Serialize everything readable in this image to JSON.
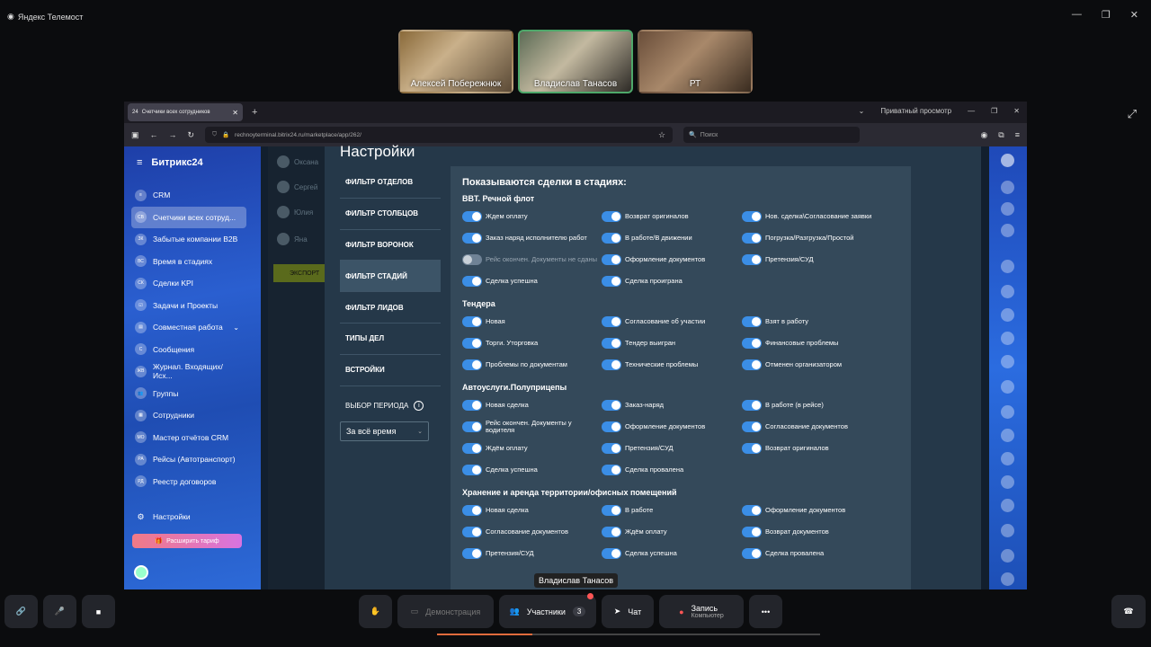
{
  "app": {
    "title": "Яндекс Телемост"
  },
  "participants": [
    {
      "name": "Алексей Побережнюк"
    },
    {
      "name": "Владислав Танасов"
    },
    {
      "name": "РТ"
    }
  ],
  "browser": {
    "tab_title": "Счетчики всех сотрудников",
    "private_label": "Приватный просмотр",
    "url": "rechnoyterminal.bitrix24.ru/marketplace/app/262/",
    "search_placeholder": "Поиск"
  },
  "sidebar": {
    "logo": "Битрикс24",
    "items": [
      {
        "icon": "≡",
        "label": "CRM"
      },
      {
        "icon": "СВ",
        "label": "Счетчики всех сотруд..."
      },
      {
        "icon": "ЗК",
        "label": "Забытые компании B2B"
      },
      {
        "icon": "ВС",
        "label": "Время в стадиях"
      },
      {
        "icon": "СК",
        "label": "Сделки KPI"
      },
      {
        "icon": "☑",
        "label": "Задачи и Проекты"
      },
      {
        "icon": "▤",
        "label": "Совместная работа"
      },
      {
        "icon": "С",
        "label": "Сообщения"
      },
      {
        "icon": "ЖВ",
        "label": "Журнал. Входящих/Исх..."
      },
      {
        "icon": "👥",
        "label": "Группы"
      },
      {
        "icon": "▦",
        "label": "Сотрудники"
      },
      {
        "icon": "МО",
        "label": "Мастер отчётов CRM"
      },
      {
        "icon": "РА",
        "label": "Рейсы (Автотранспорт)"
      },
      {
        "icon": "РД",
        "label": "Реестр договоров"
      }
    ],
    "settings": "Настройки",
    "upgrade": "Расширить тариф"
  },
  "background": {
    "names": [
      "Оксана",
      "Сергей",
      "Юлия",
      "Яна"
    ],
    "export_btn": "ЭКСПОРТ"
  },
  "settings": {
    "title": "Настройки",
    "menu": [
      "ФИЛЬТР ОТДЕЛОВ",
      "ФИЛЬТР СТОЛБЦОВ",
      "ФИЛЬТР ВОРОНОК",
      "ФИЛЬТР СТАДИЙ",
      "ФИЛЬТР ЛИДОВ",
      "ТИПЫ ДЕЛ",
      "ВСТРОЙКИ"
    ],
    "period_label": "ВЫБОР ПЕРИОДА",
    "period_value": "За всё время"
  },
  "stages": {
    "heading": "Показываются сделки в стадиях:",
    "groups": [
      {
        "title": "BBT. Речной флот",
        "items": [
          {
            "label": "Ждем оплату",
            "on": true
          },
          {
            "label": "Возврат оригиналов",
            "on": true
          },
          {
            "label": "Нов. сделка\\Согласование заявки",
            "on": true
          },
          {
            "label": "Заказ наряд исполнителю работ",
            "on": true
          },
          {
            "label": "В работе/В движении",
            "on": true
          },
          {
            "label": "Погрузка/Разгрузка/Простой",
            "on": true
          },
          {
            "label": "Рейс окончен. Документы не сданы",
            "on": false
          },
          {
            "label": "Оформление документов",
            "on": true
          },
          {
            "label": "Претензия/СУД",
            "on": true
          },
          {
            "label": "Сделка успешна",
            "on": true
          },
          {
            "label": "Сделка проиграна",
            "on": true
          }
        ]
      },
      {
        "title": "Тендера",
        "items": [
          {
            "label": "Новая",
            "on": true
          },
          {
            "label": "Согласование об участии",
            "on": true
          },
          {
            "label": "Взят в работу",
            "on": true
          },
          {
            "label": "Торги. Уторговка",
            "on": true
          },
          {
            "label": "Тендер выигран",
            "on": true
          },
          {
            "label": "Финансовые проблемы",
            "on": true
          },
          {
            "label": "Проблемы по документам",
            "on": true
          },
          {
            "label": "Технические проблемы",
            "on": true
          },
          {
            "label": "Отменен организатором",
            "on": true
          }
        ]
      },
      {
        "title": "Автоуслуги.Полуприцепы",
        "items": [
          {
            "label": "Новая сделка",
            "on": true
          },
          {
            "label": "Заказ-наряд",
            "on": true
          },
          {
            "label": "В работе (в рейсе)",
            "on": true
          },
          {
            "label": "Рейс окончен. Документы у водителя",
            "on": true
          },
          {
            "label": "Оформление документов",
            "on": true
          },
          {
            "label": "Согласование документов",
            "on": true
          },
          {
            "label": "Ждём оплату",
            "on": true
          },
          {
            "label": "Претензия/СУД",
            "on": true
          },
          {
            "label": "Возврат оригиналов",
            "on": true
          },
          {
            "label": "Сделка успешна",
            "on": true
          },
          {
            "label": "Сделка провалена",
            "on": true
          }
        ]
      },
      {
        "title": "Хранение и аренда территории/офисных помещений",
        "items": [
          {
            "label": "Новая сделка",
            "on": true
          },
          {
            "label": "В работе",
            "on": true
          },
          {
            "label": "Оформление документов",
            "on": true
          },
          {
            "label": "Согласование документов",
            "on": true
          },
          {
            "label": "Ждём оплату",
            "on": true
          },
          {
            "label": "Возврат документов",
            "on": true
          },
          {
            "label": "Претензия/СУД",
            "on": true
          },
          {
            "label": "Сделка успешна",
            "on": true
          },
          {
            "label": "Сделка провалена",
            "on": true
          }
        ]
      }
    ]
  },
  "tooltip": "Владислав Танасов",
  "toolbar": {
    "demo": "Демонстрация",
    "participants": "Участники",
    "participants_count": "3",
    "chat": "Чат",
    "record": "Запись",
    "record_sub": "Компьютер"
  }
}
